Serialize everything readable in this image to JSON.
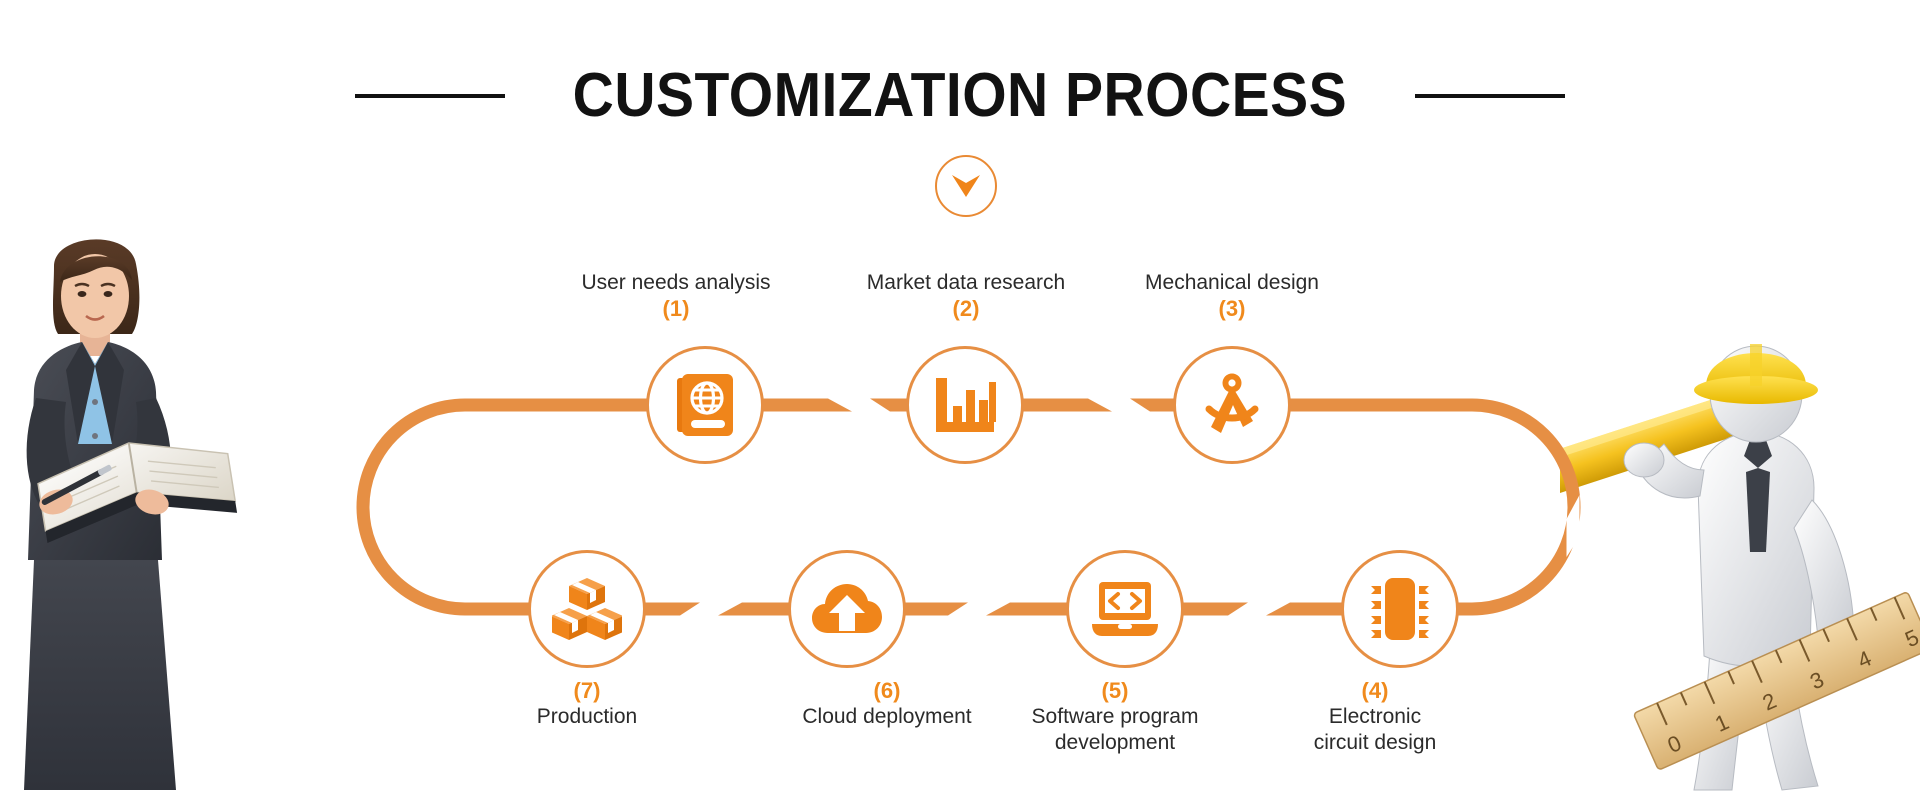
{
  "header": {
    "title": "CUSTOMIZATION PROCESS",
    "left_rule": "",
    "right_rule": "",
    "down_chevron_icon": "chevron-down-icon"
  },
  "colors": {
    "accent_orange": "#F08A1C",
    "line_orange": "#E68F44",
    "icon_orange": "#F0851A",
    "title_black": "#121212",
    "label_gray": "#2b2b2b",
    "background": "#ffffff"
  },
  "process": {
    "direction": "top row left-to-right, then down right side, bottom row right-to-left",
    "steps": [
      {
        "number": "(1)",
        "label": "User needs analysis",
        "icon": "passport-globe-book-icon",
        "row": "top",
        "order": 1
      },
      {
        "number": "(2)",
        "label": "Market data research",
        "icon": "bar-chart-icon",
        "row": "top",
        "order": 2
      },
      {
        "number": "(3)",
        "label": "Mechanical design",
        "icon": "drafting-compass-icon",
        "row": "top",
        "order": 3
      },
      {
        "number": "(4)",
        "label": "Electronic\ncircuit design",
        "icon": "microchip-icon",
        "row": "bottom",
        "order": 4
      },
      {
        "number": "(5)",
        "label": "Software program\ndevelopment",
        "icon": "laptop-code-icon",
        "row": "bottom",
        "order": 5
      },
      {
        "number": "(6)",
        "label": "Cloud deployment",
        "icon": "cloud-upload-icon",
        "row": "bottom",
        "order": 6
      },
      {
        "number": "(7)",
        "label": "Production",
        "icon": "boxes-stack-icon",
        "row": "bottom",
        "order": 7
      }
    ]
  },
  "step_labels": {
    "s1_label": "User needs analysis",
    "s1_num": "(1)",
    "s2_label": "Market data research",
    "s2_num": "(2)",
    "s3_label": "Mechanical design",
    "s3_num": "(3)",
    "s4_line1": "Electronic",
    "s4_line2": "circuit design",
    "s4_num": "(4)",
    "s5_line1": "Software program",
    "s5_line2": "development",
    "s5_num": "(5)",
    "s6_label": "Cloud deployment",
    "s6_num": "(6)",
    "s7_label": "Production",
    "s7_num": "(7)"
  },
  "decor": {
    "left_photo": "businesswoman-with-notebook-photo",
    "right_photo": "3d-character-with-pencil-and-ruler-photo",
    "ruler_marks": [
      "0",
      "1",
      "2",
      "3",
      "4",
      "5"
    ]
  }
}
